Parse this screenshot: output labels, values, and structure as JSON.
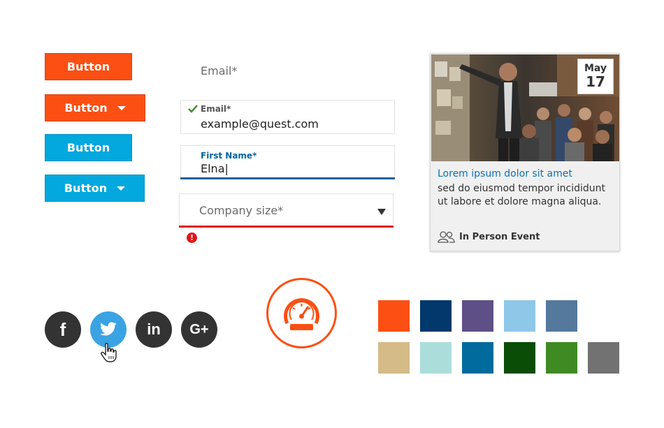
{
  "buttons": [
    {
      "label": "Button",
      "color": "#fb4f14",
      "dropdown": false
    },
    {
      "label": "Button",
      "color": "#fb4f14",
      "dropdown": true
    },
    {
      "label": "Button",
      "color": "#02a8de",
      "dropdown": false
    },
    {
      "label": "Button",
      "color": "#02a8de",
      "dropdown": true
    }
  ],
  "form": {
    "email_placeholder": "Email*",
    "email_filled": {
      "label": "Email*",
      "value": "example@quest.com",
      "status": "valid"
    },
    "first_name": {
      "label": "First Name*",
      "value": "Elna|",
      "status": "focused"
    },
    "company_size": {
      "placeholder": "Company size*",
      "status": "error",
      "error_icon": "!"
    }
  },
  "event_card": {
    "date": {
      "month": "May",
      "day": "17"
    },
    "title": "Lorem ipsum dolor sit amet",
    "text": "sed do eiusmod tempor incididunt ut labore et dolore magna aliqua.",
    "type": "In Person Event",
    "icon": "people-icon"
  },
  "social": [
    {
      "name": "facebook",
      "glyph": "f",
      "active": false
    },
    {
      "name": "twitter",
      "glyph": "",
      "active": true
    },
    {
      "name": "linkedin",
      "glyph": "in",
      "active": false
    },
    {
      "name": "google-plus",
      "glyph": "G+",
      "active": false
    }
  ],
  "swatches": [
    [
      "#fb4f14",
      "#02386c",
      "#5e4f87",
      "#8fc7e8",
      "#54799d"
    ],
    [
      "#d4bb87",
      "#abdedb",
      "#006b9c",
      "#0a4d07",
      "#408a23",
      "#727272"
    ]
  ]
}
